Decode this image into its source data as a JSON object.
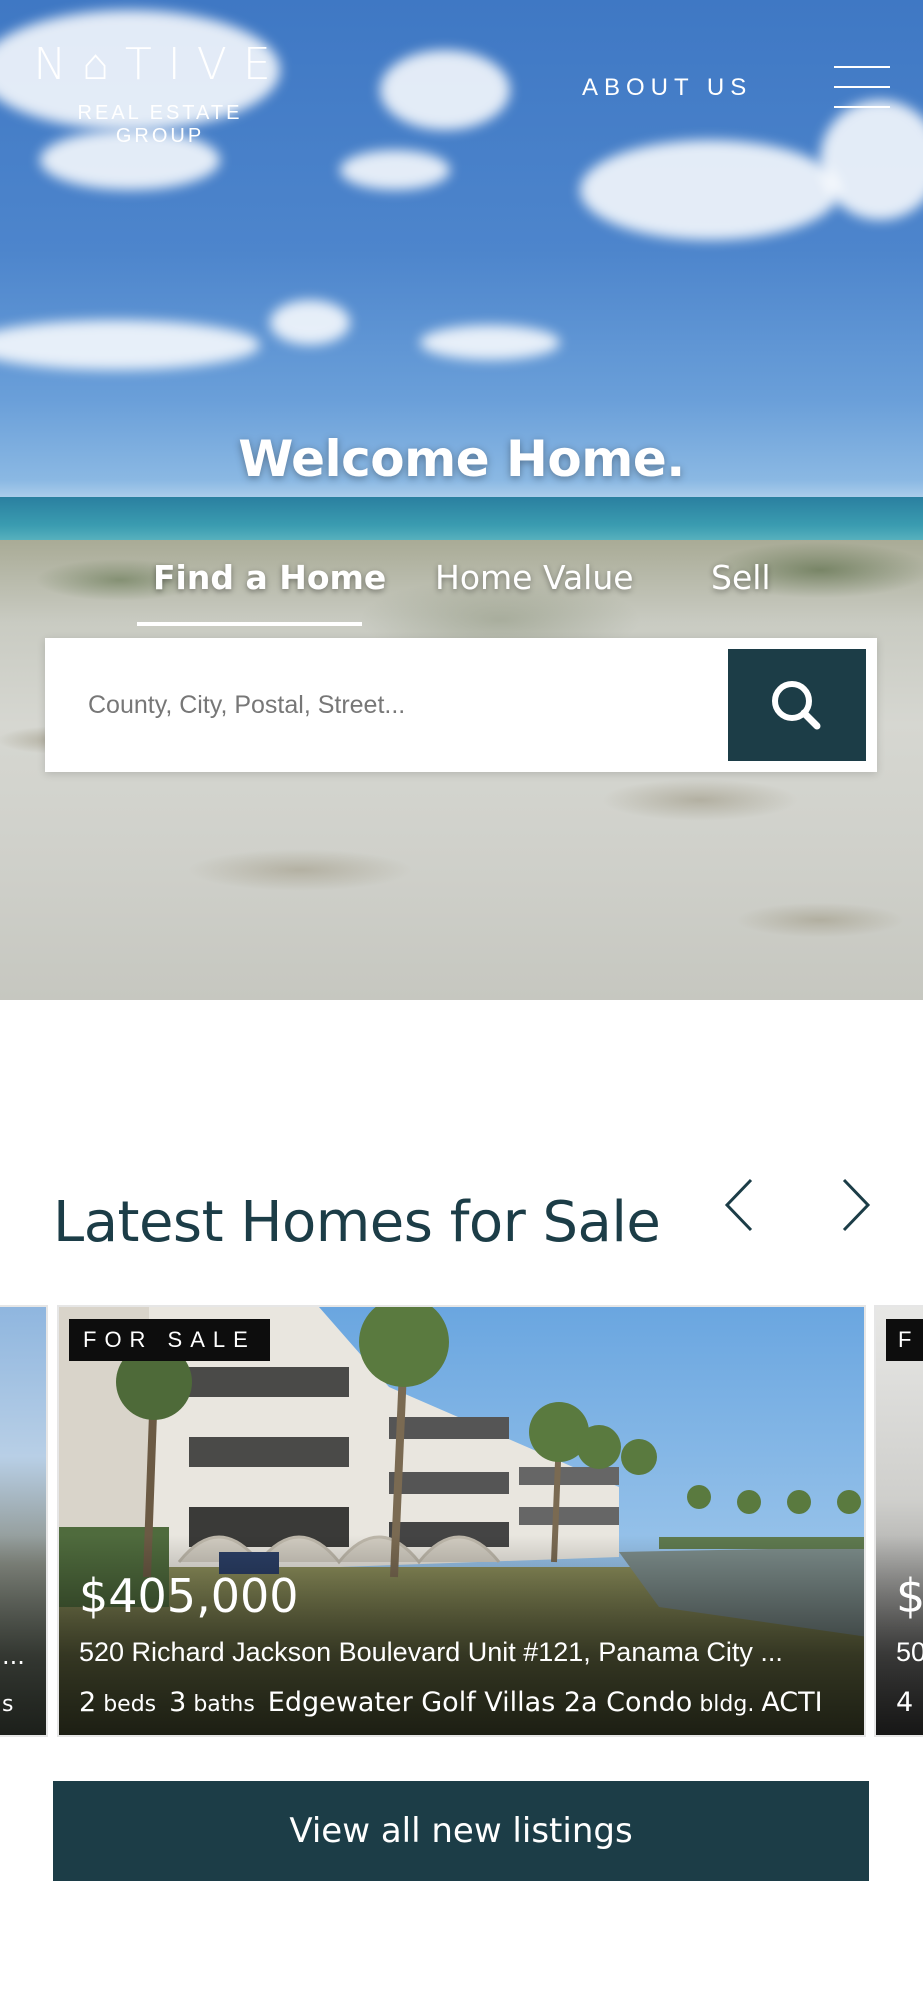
{
  "brand": {
    "logo_word": "N⌂TIVE",
    "logo_sub": "REAL ESTATE GROUP"
  },
  "nav": {
    "about_label": "ABOUT US",
    "menu_icon": "hamburger-menu-icon"
  },
  "hero": {
    "title": "Welcome Home.",
    "tabs": [
      {
        "label": "Find a Home",
        "active": true
      },
      {
        "label": "Home Value",
        "active": false
      },
      {
        "label": "Sell",
        "active": false
      }
    ],
    "search": {
      "placeholder": "County, City, Postal, Street...",
      "value": "",
      "button_icon": "search-icon"
    }
  },
  "listings": {
    "title": "Latest Homes for Sale",
    "prev_icon": "chevron-left-icon",
    "next_icon": "chevron-right-icon",
    "cards": [
      {
        "badge": "FOR SALE",
        "price": "$405,000",
        "address": "520 Richard Jackson Boulevard Unit #121, Panama City ...",
        "beds": "2",
        "beds_label": "beds",
        "baths": "3",
        "baths_label": "baths",
        "building": "Edgewater Golf Villas 2a Condo",
        "building_label": "bldg.",
        "status": "ACTI"
      }
    ],
    "peek_left": {
      "address_tail": "...",
      "meta_tail": "s"
    },
    "peek_right": {
      "badge": "F",
      "price": "$",
      "address": "50",
      "beds": "4"
    },
    "cta_label": "View all new listings"
  },
  "colors": {
    "brand_dark": "#1c3d47",
    "badge_bg": "#0d0d0d"
  }
}
